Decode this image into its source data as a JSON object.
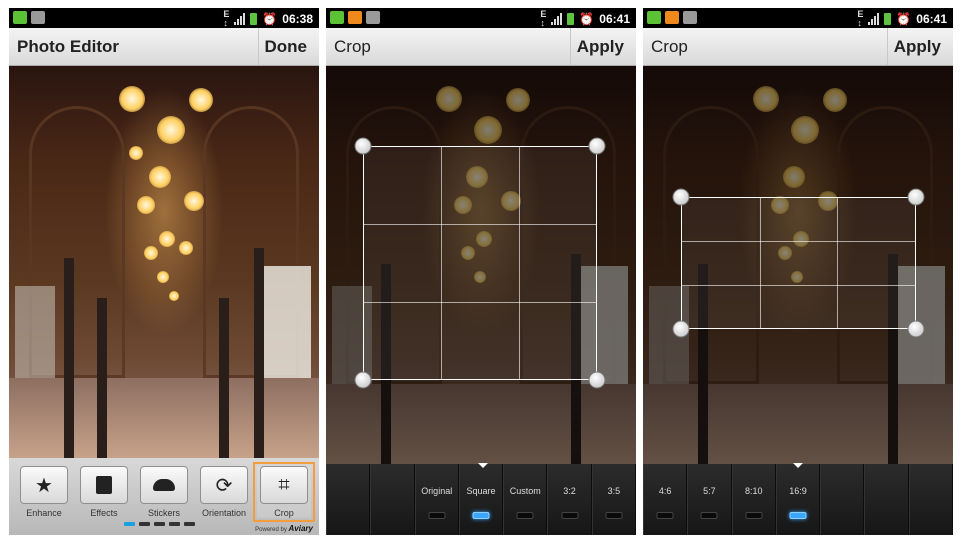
{
  "status": {
    "time": "06:38",
    "time2": "06:41",
    "time3": "06:41"
  },
  "screen1": {
    "title": "Photo Editor",
    "action": "Done",
    "tools": [
      {
        "label": "Enhance",
        "icon": "star-icon"
      },
      {
        "label": "Effects",
        "icon": "effects-icon"
      },
      {
        "label": "Stickers",
        "icon": "stickers-icon"
      },
      {
        "label": "Orientation",
        "icon": "orientation-icon"
      },
      {
        "label": "Crop",
        "icon": "crop-icon"
      }
    ],
    "selected_tool": "Crop",
    "page_indicator": {
      "pages": 5,
      "current": 1
    },
    "powered_by": "Powered by",
    "brand": "Aviary"
  },
  "screen2": {
    "title": "Crop",
    "action": "Apply",
    "ratios": [
      "",
      "",
      "Original",
      "Square",
      "Custom",
      "3:2",
      "3:5"
    ],
    "selected": "Square"
  },
  "screen3": {
    "title": "Crop",
    "action": "Apply",
    "ratios": [
      "4:6",
      "5:7",
      "8:10",
      "16:9",
      "",
      "",
      ""
    ],
    "selected": "16:9"
  },
  "colors": {
    "accent_blue": "#3aa6ff",
    "selection_orange": "#f39d3d"
  }
}
